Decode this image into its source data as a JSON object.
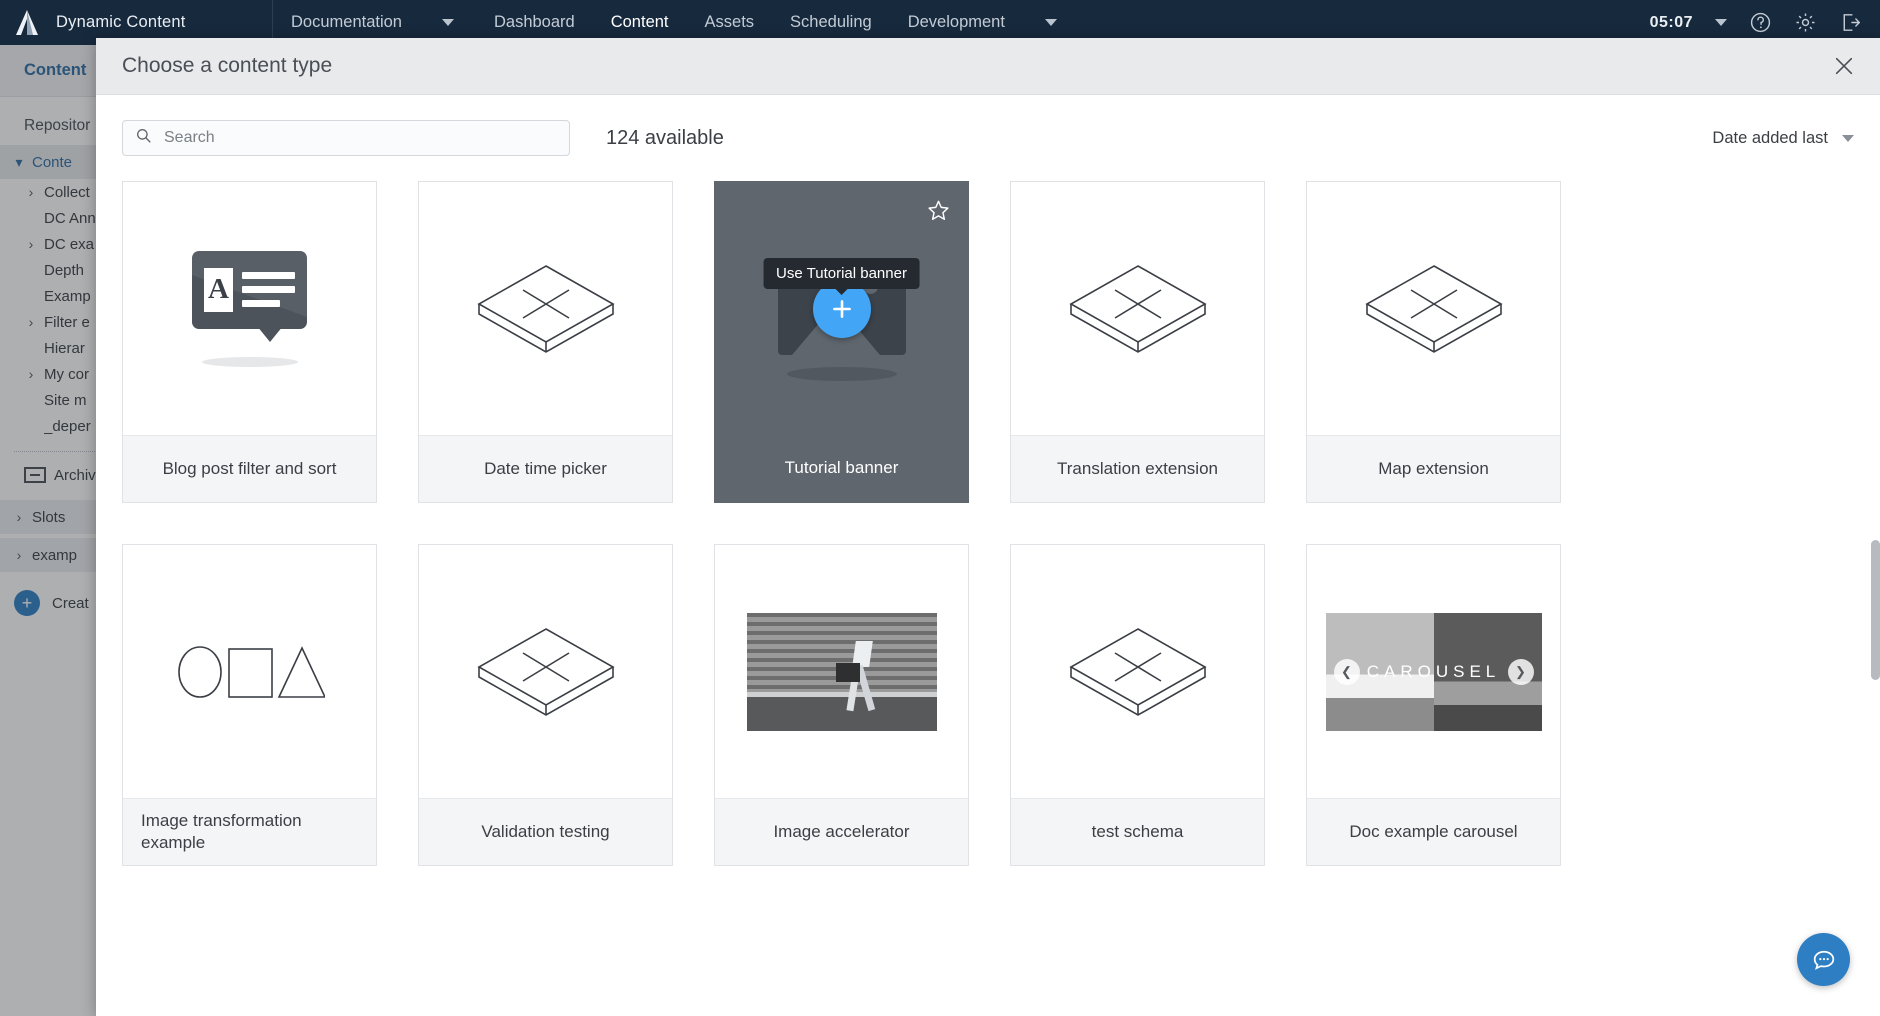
{
  "topbar": {
    "logo_icon": "amplience-logo-icon",
    "brand": "Dynamic Content",
    "menu_label": "Documentation",
    "menu_caret_icon": "chevron-down-icon",
    "nav": [
      {
        "label": "Dashboard",
        "active": false
      },
      {
        "label": "Content",
        "active": true
      },
      {
        "label": "Assets",
        "active": false
      },
      {
        "label": "Scheduling",
        "active": false
      },
      {
        "label": "Development",
        "active": false
      }
    ],
    "nav_caret_icon": "chevron-down-icon",
    "clock": "05:07",
    "clock_caret_icon": "chevron-down-icon",
    "help_icon": "question-circle-icon",
    "settings_icon": "gear-icon",
    "logout_icon": "sign-out-icon"
  },
  "sidebar": {
    "tab": "Content",
    "section": "Repositor",
    "root": {
      "label": "Conte",
      "chevron_icon": "chevron-down-icon"
    },
    "items": [
      {
        "label": "Collect",
        "expandable": true
      },
      {
        "label": "DC Ann",
        "expandable": false
      },
      {
        "label": "DC exa",
        "expandable": true
      },
      {
        "label": "Depth",
        "expandable": false
      },
      {
        "label": "Examp",
        "expandable": false
      },
      {
        "label": "Filter e",
        "expandable": true
      },
      {
        "label": "Hierar",
        "expandable": false
      },
      {
        "label": "My cor",
        "expandable": true
      },
      {
        "label": "Site m",
        "expandable": false
      },
      {
        "label": "_deper",
        "expandable": false
      }
    ],
    "archived": {
      "label": "Archiv",
      "icon": "archive-box-icon"
    },
    "slots": {
      "label": "Slots",
      "chevron_icon": "chevron-right-icon"
    },
    "examples": {
      "label": "examp",
      "chevron_icon": "chevron-right-icon"
    },
    "create": {
      "label": "Creat",
      "icon": "plus-circle-icon"
    }
  },
  "modal": {
    "title": "Choose a content type",
    "close_icon": "close-icon",
    "search": {
      "placeholder": "Search",
      "value": "",
      "icon": "search-icon"
    },
    "available": "124 available",
    "sort": {
      "label": "Date added last",
      "caret_icon": "chevron-down-icon"
    },
    "selected_card_index": 2,
    "selected_overlay": {
      "tooltip": "Use Tutorial banner",
      "action_icon": "plus-icon",
      "favourite_icon": "star-outline-icon"
    },
    "cards": [
      {
        "label": "Blog post filter and sort",
        "thumb": "blog-bubble-icon",
        "label_align": "center"
      },
      {
        "label": "Date time picker",
        "thumb": "placeholder-slab-icon",
        "label_align": "center"
      },
      {
        "label": "Tutorial banner",
        "thumb": "image-placeholder-icon",
        "label_align": "center"
      },
      {
        "label": "Translation extension",
        "thumb": "placeholder-slab-icon",
        "label_align": "center"
      },
      {
        "label": "Map extension",
        "thumb": "placeholder-slab-icon",
        "label_align": "center"
      },
      {
        "label": "Image transformation example",
        "thumb": "shapes-icon",
        "label_align": "left"
      },
      {
        "label": "Validation testing",
        "thumb": "placeholder-slab-icon",
        "label_align": "center"
      },
      {
        "label": "Image accelerator",
        "thumb": "walker-photo",
        "label_align": "center"
      },
      {
        "label": "test schema",
        "thumb": "placeholder-slab-icon",
        "label_align": "center"
      },
      {
        "label": "Doc example carousel",
        "thumb": "carousel-photo",
        "label_align": "center"
      }
    ],
    "carousel": {
      "word": "CAROUSEL",
      "prev_icon": "chevron-left-icon",
      "next_icon": "chevron-right-icon"
    }
  },
  "chat": {
    "icon": "chat-bubble-icon"
  },
  "colors": {
    "topbar_bg": "#17293d",
    "accent_teal": "#5fdbb0",
    "accent_blue": "#2e7ec4",
    "fab_blue": "#42a5f5",
    "selected_card_bg": "#5f666e",
    "tooltip_bg": "#252a31"
  }
}
